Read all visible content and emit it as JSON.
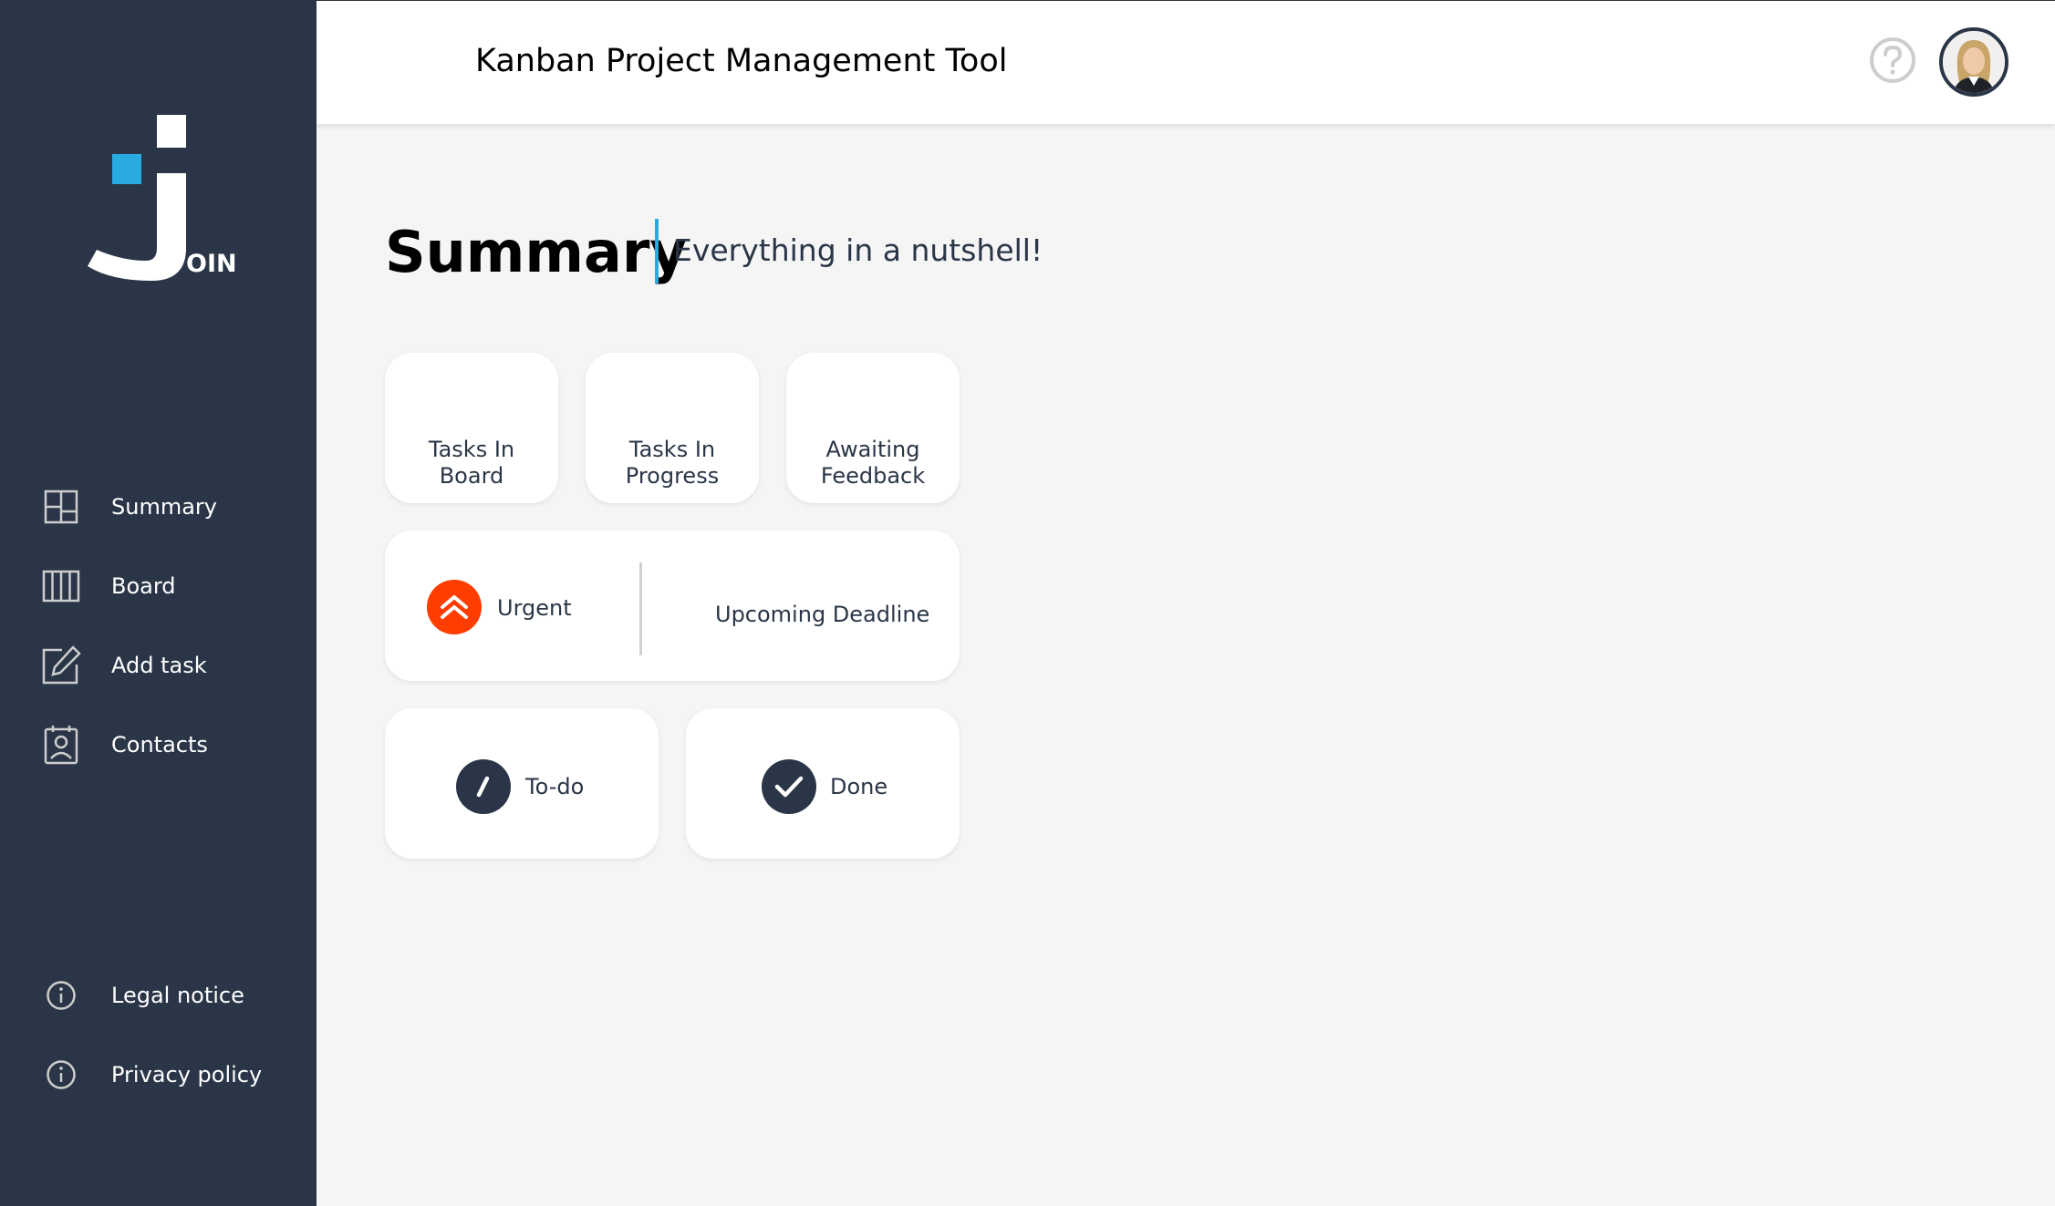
{
  "app": {
    "logo_text": "OIN",
    "header_title": "Kanban Project Management Tool"
  },
  "sidebar": {
    "items": [
      {
        "label": "Summary",
        "icon": "summary-icon"
      },
      {
        "label": "Board",
        "icon": "board-icon"
      },
      {
        "label": "Add task",
        "icon": "edit-icon"
      },
      {
        "label": "Contacts",
        "icon": "contacts-icon"
      }
    ],
    "footer_items": [
      {
        "label": "Legal notice",
        "icon": "info-icon"
      },
      {
        "label": "Privacy policy",
        "icon": "info-icon"
      }
    ]
  },
  "main": {
    "title": "Summary",
    "subtitle": "Everything in a nutshell!",
    "cards": {
      "tasks_in_board": "Tasks In Board",
      "tasks_in_progress": "Tasks In Progress",
      "awaiting_feedback": "Awaiting Feedback",
      "urgent": "Urgent",
      "upcoming_deadline": "Upcoming Deadline",
      "todo": "To-do",
      "done": "Done"
    }
  },
  "colors": {
    "sidebar": "#2a3647",
    "accent": "#29abe2",
    "urgent": "#ff3d00"
  }
}
